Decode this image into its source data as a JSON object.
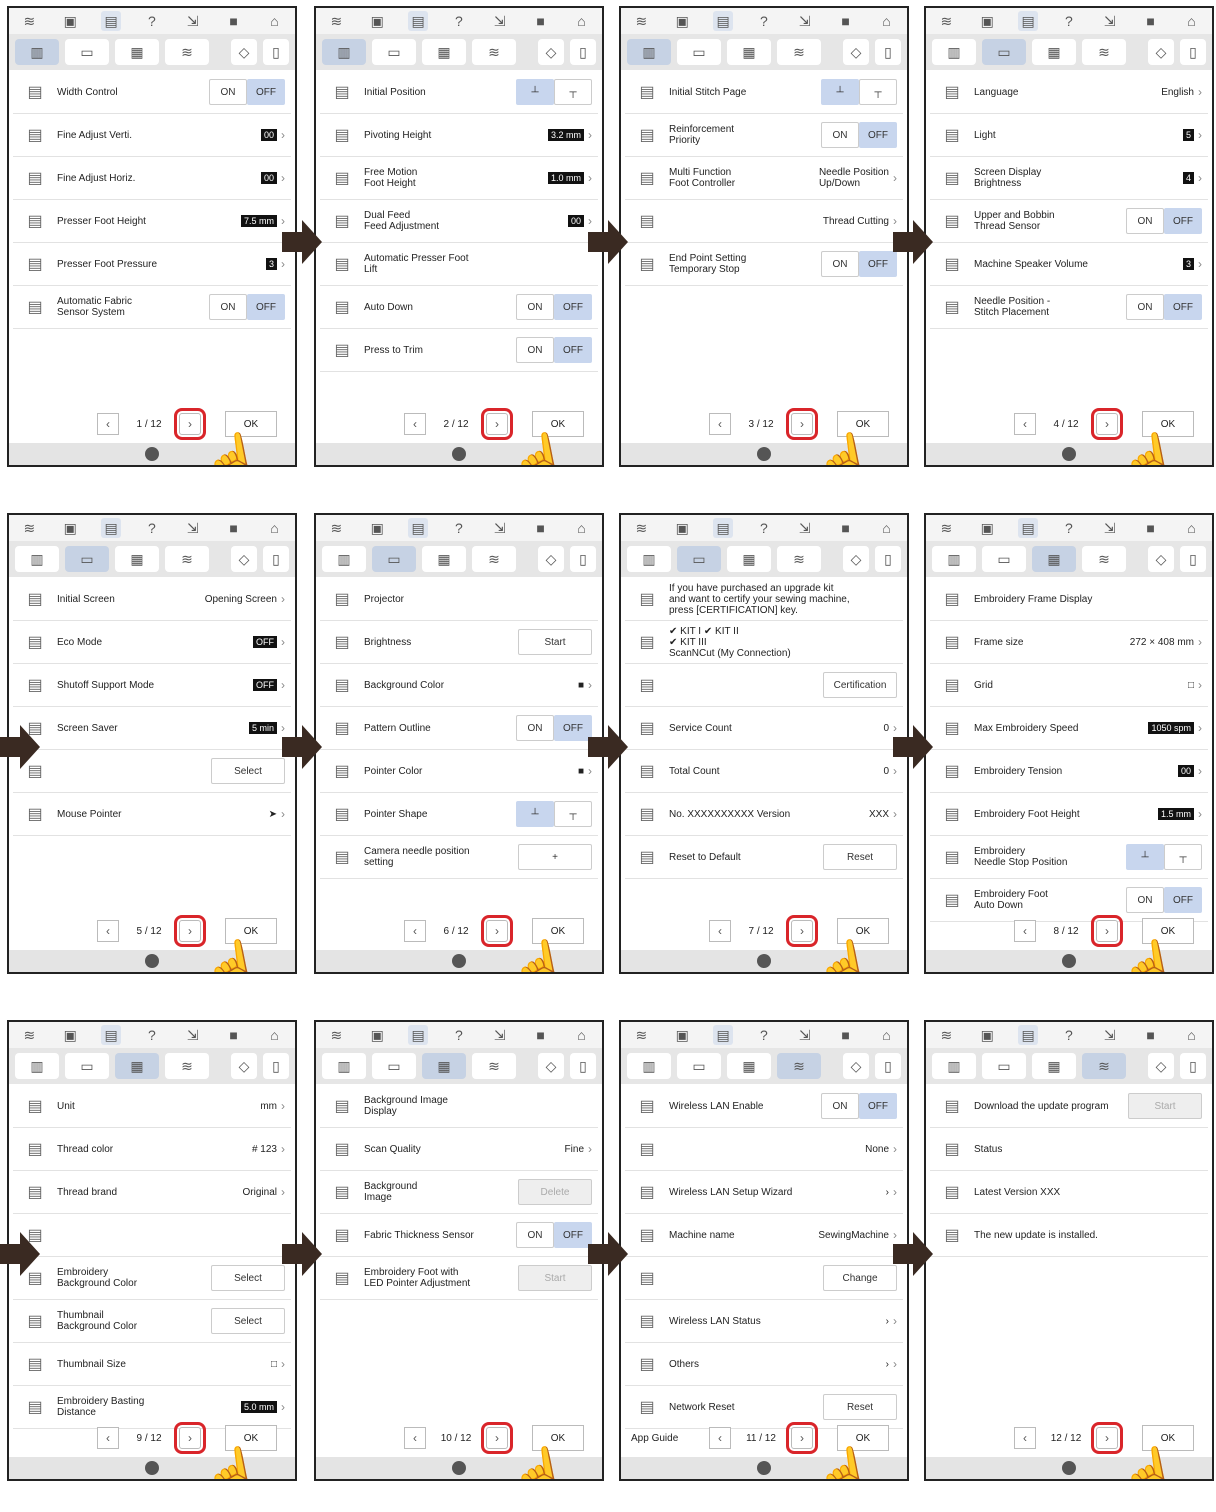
{
  "icons": {
    "wifi": "wifi-icon",
    "camera": "camera-icon",
    "page": "page-icon",
    "help": "help-icon",
    "thread": "thread-icon",
    "lock": "lock-icon",
    "home": "home-icon"
  },
  "ok": "OK",
  "panels": [
    {
      "page": "1",
      "total": "12",
      "rows": [
        {
          "label": "Width Control",
          "control": "onoff",
          "on": "ON",
          "off": "OFF"
        },
        {
          "label": "Fine Adjust Verti.",
          "value": "00",
          "box": true
        },
        {
          "label": "Fine Adjust Horiz.",
          "value": "00",
          "box": true
        },
        {
          "label": "Presser Foot Height",
          "value": "7.5 mm",
          "box": true
        },
        {
          "label": "Presser Foot Pressure",
          "value": "3",
          "box": true
        },
        {
          "label": "Automatic Fabric\nSensor System",
          "control": "onoff",
          "on": "ON",
          "off": "OFF"
        }
      ]
    },
    {
      "page": "2",
      "total": "12",
      "rows": [
        {
          "label": "Initial Position",
          "control": "pos"
        },
        {
          "label": "Pivoting Height",
          "value": "3.2 mm",
          "box": true
        },
        {
          "label": "Free Motion\nFoot Height",
          "value": "1.0 mm",
          "box": true
        },
        {
          "label": "Dual Feed\nFeed Adjustment",
          "value": "00",
          "box": true
        },
        {
          "label": "Automatic Presser Foot\nLift"
        },
        {
          "label": "Auto Down",
          "control": "onoff",
          "on": "ON",
          "off": "OFF"
        },
        {
          "label": "Press to Trim",
          "control": "onoff",
          "on": "ON",
          "off": "OFF"
        }
      ]
    },
    {
      "page": "3",
      "total": "12",
      "rows": [
        {
          "label": "Initial Stitch Page",
          "control": "pos"
        },
        {
          "label": "Reinforcement\nPriority",
          "control": "onoff",
          "on": "ON",
          "off": "OFF"
        },
        {
          "label": "Multi Function\nFoot Controller",
          "value": "Needle Position\nUp/Down"
        },
        {
          "label": "",
          "value": "Thread Cutting"
        },
        {
          "label": "End Point Setting\nTemporary Stop",
          "control": "onoff",
          "on": "ON",
          "off": "OFF"
        }
      ]
    },
    {
      "page": "4",
      "total": "12",
      "rows": [
        {
          "label": "Language",
          "value": "English"
        },
        {
          "label": "Light",
          "value": "5",
          "box": true
        },
        {
          "label": "Screen Display\nBrightness",
          "value": "4",
          "box": true
        },
        {
          "label": "Upper and Bobbin\nThread Sensor",
          "control": "onoff",
          "on": "ON",
          "off": "OFF"
        },
        {
          "label": "Machine Speaker Volume",
          "value": "3",
          "box": true
        },
        {
          "label": "Needle Position -\nStitch Placement",
          "control": "onoff",
          "on": "ON",
          "off": "OFF"
        }
      ]
    },
    {
      "page": "5",
      "total": "12",
      "rows": [
        {
          "label": "Initial Screen",
          "value": "Opening Screen"
        },
        {
          "label": "Eco Mode",
          "value": "OFF",
          "box": true
        },
        {
          "label": "Shutoff Support Mode",
          "value": "OFF",
          "box": true
        },
        {
          "label": "Screen Saver",
          "value": "5 min",
          "box": true
        },
        {
          "label": "",
          "control": "btn",
          "btn": "Select"
        },
        {
          "label": "Mouse Pointer",
          "value": "➤"
        }
      ]
    },
    {
      "page": "6",
      "total": "12",
      "rows": [
        {
          "label": "Projector"
        },
        {
          "label": "Brightness",
          "control": "btn",
          "btn": "Start"
        },
        {
          "label": "Background Color",
          "value": "■"
        },
        {
          "label": "Pattern Outline",
          "control": "onoff",
          "on": "ON",
          "off": "OFF"
        },
        {
          "label": "Pointer Color",
          "value": "■"
        },
        {
          "label": "Pointer Shape",
          "control": "pos"
        },
        {
          "label": "Camera needle position\nsetting",
          "control": "btn",
          "btn": "+"
        }
      ]
    },
    {
      "page": "7",
      "total": "12",
      "rows": [
        {
          "label": "If you have purchased an upgrade kit\nand want to certify your sewing machine,\npress [CERTIFICATION] key."
        },
        {
          "label": "✔ KIT I    ✔ KIT II\n✔ KIT III\nScanNCut (My Connection)"
        },
        {
          "label": "",
          "control": "btn",
          "btn": "Certification"
        },
        {
          "label": "Service Count",
          "value": "0"
        },
        {
          "label": "Total Count",
          "value": "0"
        },
        {
          "label": "No.    XXXXXXXXXX      Version",
          "value": "XXX"
        },
        {
          "label": "Reset to Default",
          "control": "btn",
          "btn": "Reset"
        }
      ]
    },
    {
      "page": "8",
      "total": "12",
      "rows": [
        {
          "label": "Embroidery Frame Display"
        },
        {
          "label": "Frame size",
          "value": "272 × 408 mm"
        },
        {
          "label": "Grid",
          "value": "□"
        },
        {
          "label": "Max Embroidery Speed",
          "value": "1050 spm",
          "box": true
        },
        {
          "label": "Embroidery Tension",
          "value": "00",
          "box": true
        },
        {
          "label": "Embroidery Foot Height",
          "value": "1.5 mm",
          "box": true
        },
        {
          "label": "Embroidery\nNeedle Stop Position",
          "control": "pos"
        },
        {
          "label": "Embroidery Foot\nAuto Down",
          "control": "onoff",
          "on": "ON",
          "off": "OFF"
        }
      ]
    },
    {
      "page": "9",
      "total": "12",
      "rows": [
        {
          "label": "Unit",
          "value": "mm"
        },
        {
          "label": "Thread color",
          "value": "# 123"
        },
        {
          "label": "Thread brand",
          "value": "Original"
        },
        {
          "label": ""
        },
        {
          "label": "Embroidery\nBackground Color",
          "control": "btn",
          "btn": "Select"
        },
        {
          "label": "Thumbnail\nBackground Color",
          "control": "btn",
          "btn": "Select"
        },
        {
          "label": "Thumbnail Size",
          "value": "□"
        },
        {
          "label": "Embroidery Basting\nDistance",
          "value": "5.0 mm",
          "box": true
        }
      ]
    },
    {
      "page": "10",
      "total": "12",
      "rows": [
        {
          "label": "Background Image\nDisplay"
        },
        {
          "label": "Scan Quality",
          "value": "Fine"
        },
        {
          "label": "Background\nImage",
          "control": "btn",
          "btn": "Delete",
          "dis": true
        },
        {
          "label": "Fabric Thickness Sensor",
          "control": "onoff",
          "on": "ON",
          "off": "OFF"
        },
        {
          "label": "Embroidery Foot with\nLED Pointer Adjustment",
          "control": "btn",
          "btn": "Start",
          "dis": true
        }
      ]
    },
    {
      "page": "11",
      "total": "12",
      "rows": [
        {
          "label": "Wireless LAN Enable",
          "control": "onoff",
          "on": "ON",
          "off": "OFF"
        },
        {
          "label": "",
          "value": "None"
        },
        {
          "label": "Wireless LAN Setup Wizard",
          "value": "›"
        },
        {
          "label": "Machine name",
          "value": "SewingMachine"
        },
        {
          "label": "",
          "control": "btn",
          "btn": "Change"
        },
        {
          "label": "Wireless LAN Status",
          "value": "›"
        },
        {
          "label": "Others",
          "value": "›"
        },
        {
          "label": "Network Reset",
          "control": "btn",
          "btn": "Reset"
        }
      ],
      "guide": "App Guide"
    },
    {
      "page": "12",
      "total": "12",
      "rows": [
        {
          "label": "Download the update program",
          "control": "btn",
          "btn": "Start",
          "dis": true
        },
        {
          "label": "Status"
        },
        {
          "label": "Latest Version          XXX"
        },
        {
          "label": "The new update is installed."
        }
      ]
    }
  ]
}
